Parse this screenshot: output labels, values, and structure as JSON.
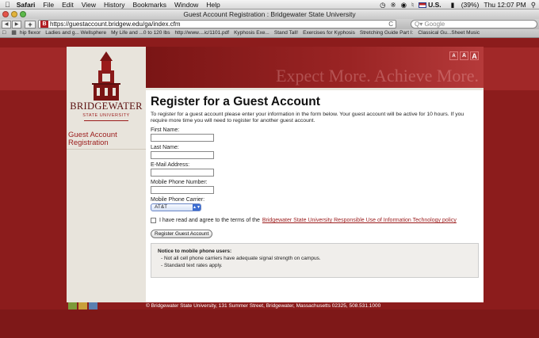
{
  "menubar": {
    "app": "Safari",
    "items": [
      "File",
      "Edit",
      "View",
      "History",
      "Bookmarks",
      "Window",
      "Help"
    ],
    "input_source": "U.S.",
    "battery": "(39%)",
    "clock": "Thu 12:07 PM"
  },
  "window": {
    "title": "Guest Account Registration : Bridgewater State University"
  },
  "toolbar": {
    "back": "◀",
    "forward": "▶",
    "add": "+",
    "url": "https://guestaccount.bridgew.edu/ga/index.cfm",
    "favicon_letter": "B",
    "reload": "C",
    "search_placeholder": "Q▾ Google"
  },
  "bookmarks": [
    "hip flexor",
    "Ladies and g... Wellsphere",
    "My Life and ...0 to 120 lbs",
    "http://www....ic/1101.pdf",
    "Kyphosis Exe...",
    "Stand Tall!",
    "Exercises for Kyphosis",
    "Stretching Guide Part I:",
    "Classical Gu...Sheet Music"
  ],
  "site": {
    "logo_name": "BRIDGEWATER",
    "logo_sub": "STATE UNIVERSITY",
    "tagline": "Expect More. Achieve More.",
    "size_buttons": [
      "A",
      "A",
      "A"
    ],
    "nav": [
      "Guest Account Registration"
    ],
    "accent_color": "#9b1b1b"
  },
  "form": {
    "heading": "Register for a Guest Account",
    "intro": "To register for a guest account please enter your information in the form below. Your guest account will be active for 10 hours. If you require more time you will need to register for another guest account.",
    "first_name_label": "First Name:",
    "last_name_label": "Last Name:",
    "email_label": "E-Mail Address:",
    "phone_label": "Mobile Phone Number:",
    "carrier_label": "Mobile Phone Carrier:",
    "carrier_value": "AT&T",
    "agree_text": "I have read and agree to the terms of the",
    "agree_link": "Bridgewater State University Responsible Use of Information Technology policy",
    "submit_label": "Register Guest Account"
  },
  "notice": {
    "title": "Notice to mobile phone users:",
    "items": [
      "- Not all cell phone carriers have adequate signal strength on campus.",
      "- Standard text rates apply."
    ]
  },
  "footer": {
    "text": "© Bridgewater State University, 131 Summer Street, Bridgewater, Massachusetts 02325, 508.531.1000",
    "swatch_colors": [
      "#7d9a3a",
      "#c9a03a",
      "#5a7fb0"
    ]
  }
}
